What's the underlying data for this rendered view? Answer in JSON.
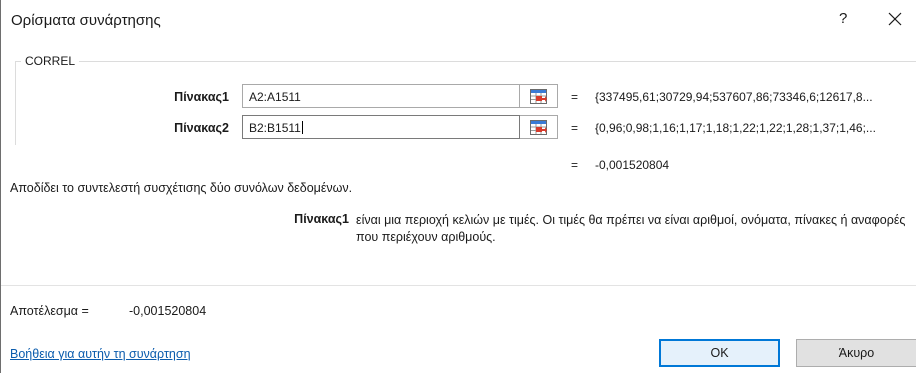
{
  "window": {
    "title": "Ορίσματα συνάρτησης",
    "help_glyph": "?",
    "close_glyph": "×"
  },
  "function_name": "CORREL",
  "arguments": [
    {
      "label": "Πίνακας1",
      "input_value": "A2:A1511",
      "equals": "=",
      "evaluated": "{337495,61;30729,94;537607,86;73346,6;12617,8..."
    },
    {
      "label": "Πίνακας2",
      "input_value": "B2:B1511",
      "equals": "=",
      "evaluated": "{0,96;0,98;1,16;1,17;1,18;1,22;1,22;1,28;1,37;1,46;..."
    }
  ],
  "formula_result": {
    "equals": "=",
    "value": "-0,001520804"
  },
  "function_description": "Αποδίδει το συντελεστή συσχέτισης δύο συνόλων δεδομένων.",
  "argument_help": {
    "name": "Πίνακας1",
    "text": "είναι μια περιοχή κελιών με τιμές. Οι τιμές θα πρέπει να είναι αριθμοί, ονόματα, πίνακες ή αναφορές που περιέχουν αριθμούς."
  },
  "result": {
    "label": "Αποτέλεσμα =",
    "value": "-0,001520804"
  },
  "help_link": "Βοήθεια για αυτήν τη συνάρτηση",
  "buttons": {
    "ok": "OK",
    "cancel": "Άκυρο"
  },
  "colors": {
    "accent": "#0078d7",
    "link": "#0b5cad"
  }
}
